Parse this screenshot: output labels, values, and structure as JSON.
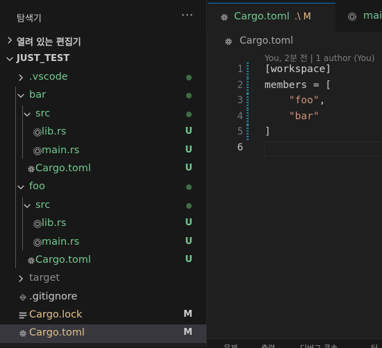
{
  "explorer": {
    "title": "탐색기",
    "more_label": "···",
    "open_editors_label": "열려 있는 편집기",
    "workspace_label": "JUST_TEST"
  },
  "tree": [
    {
      "label": ".vscode",
      "kind": "folder",
      "expanded": false,
      "depth": 1,
      "color": "green",
      "decoration": "dot"
    },
    {
      "label": "bar",
      "kind": "folder",
      "expanded": true,
      "depth": 1,
      "color": "green",
      "decoration": "dot"
    },
    {
      "label": "src",
      "kind": "folder",
      "expanded": true,
      "depth": 2,
      "color": "green",
      "decoration": "dot"
    },
    {
      "label": "lib.rs",
      "kind": "rust",
      "depth": 3,
      "color": "green",
      "decoration": "U"
    },
    {
      "label": "main.rs",
      "kind": "rust",
      "depth": 3,
      "color": "green",
      "decoration": "U"
    },
    {
      "label": "Cargo.toml",
      "kind": "gear",
      "depth": 2,
      "color": "green",
      "decoration": "U"
    },
    {
      "label": "foo",
      "kind": "folder",
      "expanded": true,
      "depth": 1,
      "color": "green",
      "decoration": "dot"
    },
    {
      "label": "src",
      "kind": "folder",
      "expanded": true,
      "depth": 2,
      "color": "green",
      "decoration": "dot"
    },
    {
      "label": "lib.rs",
      "kind": "rust",
      "depth": 3,
      "color": "green",
      "decoration": "U"
    },
    {
      "label": "main.rs",
      "kind": "rust",
      "depth": 3,
      "color": "green",
      "decoration": "U"
    },
    {
      "label": "Cargo.toml",
      "kind": "gear",
      "depth": 2,
      "color": "green",
      "decoration": "U"
    },
    {
      "label": "target",
      "kind": "folder",
      "expanded": false,
      "depth": 1,
      "color": "gray",
      "decoration": ""
    },
    {
      "label": ".gitignore",
      "kind": "git",
      "depth": 1,
      "color": "light",
      "decoration": ""
    },
    {
      "label": "Cargo.lock",
      "kind": "lines",
      "depth": 1,
      "color": "mod",
      "decoration": "M"
    },
    {
      "label": "Cargo.toml",
      "kind": "gear",
      "depth": 1,
      "color": "mod",
      "decoration": "M",
      "selected": true
    }
  ],
  "tabs": [
    {
      "name": "Cargo.toml",
      "suffix": ".\\ M",
      "active": true
    },
    {
      "name": "main",
      "active": false
    }
  ],
  "breadcrumb": "Cargo.toml",
  "blame": "You, 2분 전 | 1 author (You)",
  "code": [
    {
      "n": "1",
      "parts": [
        {
          "t": "[workspace]",
          "c": "c-bracket"
        }
      ]
    },
    {
      "n": "2",
      "parts": [
        {
          "t": "members = [",
          "c": "c-key"
        }
      ]
    },
    {
      "n": "3",
      "parts": [
        {
          "t": "    ",
          "c": "c-key"
        },
        {
          "t": "\"foo\"",
          "c": "c-str"
        },
        {
          "t": ",",
          "c": "c-key"
        }
      ]
    },
    {
      "n": "4",
      "parts": [
        {
          "t": "    ",
          "c": "c-key"
        },
        {
          "t": "\"bar\"",
          "c": "c-str"
        }
      ]
    },
    {
      "n": "5",
      "parts": [
        {
          "t": "]",
          "c": "c-key"
        }
      ]
    },
    {
      "n": "6",
      "parts": []
    }
  ],
  "panel_tabs": [
    "문제",
    "출력",
    "디버그 콘솔",
    "터"
  ],
  "colors": {
    "accent": "#0078d4",
    "untracked": "#73c991",
    "modified": "#e2c08d",
    "gutter": "#1b81a8"
  }
}
